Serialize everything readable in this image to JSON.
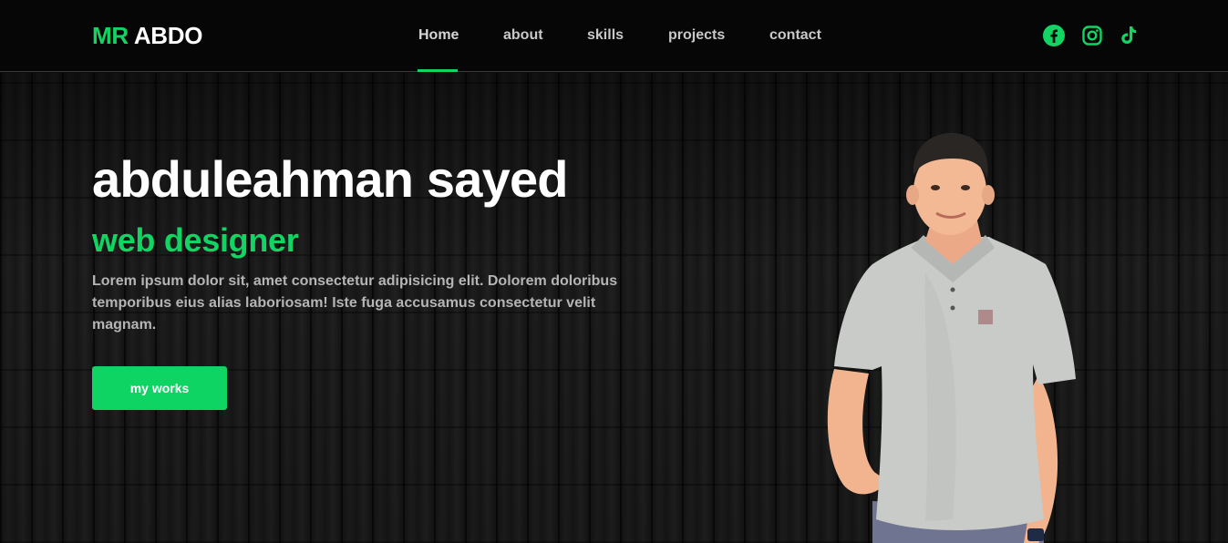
{
  "header": {
    "logo_accent": "MR",
    "logo_rest": "ABDO",
    "nav": [
      {
        "label": "Home",
        "active": true
      },
      {
        "label": "about",
        "active": false
      },
      {
        "label": "skills",
        "active": false
      },
      {
        "label": "projects",
        "active": false
      },
      {
        "label": "contact",
        "active": false
      }
    ],
    "socials": [
      "facebook-icon",
      "instagram-icon",
      "tiktok-icon"
    ]
  },
  "hero": {
    "name": "abduleahman sayed",
    "role": "web designer",
    "description": "Lorem ipsum dolor sit, amet consectetur adipisicing elit. Dolorem doloribus temporibus eius alias laboriosam! Iste fuga accusamus consectetur velit magnam.",
    "cta_label": "my works"
  },
  "colors": {
    "accent": "#12d463",
    "header_bg": "#060606",
    "text_primary": "#ffffff",
    "text_muted": "#b5b5b5"
  }
}
